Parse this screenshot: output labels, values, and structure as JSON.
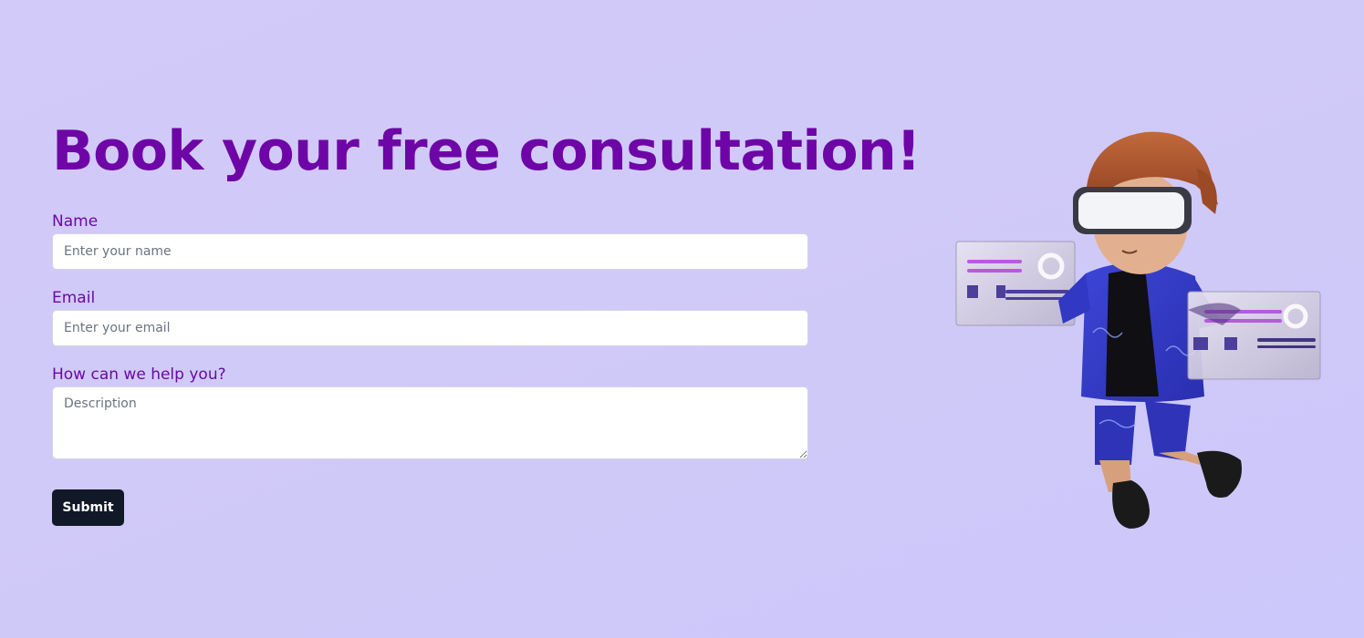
{
  "heading": "Book your free consultation!",
  "form": {
    "name_label": "Name",
    "name_placeholder": "Enter your name",
    "email_label": "Email",
    "email_placeholder": "Enter your email",
    "help_label": "How can we help you?",
    "help_placeholder": "Description",
    "submit_label": "Submit"
  },
  "colors": {
    "heading": "#6e05a6",
    "label": "#6a0aa3",
    "button": "#111827",
    "background": "#d2cbf9"
  },
  "illustration": {
    "icon": "vr-character-illustration"
  }
}
